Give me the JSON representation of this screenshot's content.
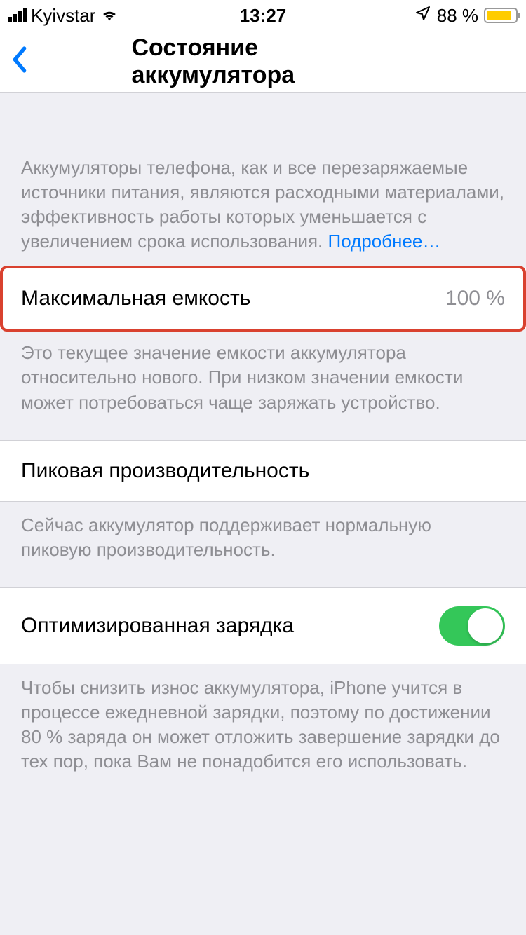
{
  "statusBar": {
    "carrier": "Kyivstar",
    "time": "13:27",
    "batteryPercent": "88 %"
  },
  "nav": {
    "title": "Состояние аккумулятора"
  },
  "intro": {
    "text": "Аккумуляторы телефона, как и все перезаряжаемые источники питания, являются расходными материалами, эффективность работы которых уменьшается с увеличением срока использования. ",
    "linkText": "Подробнее…"
  },
  "maxCapacity": {
    "label": "Максимальная емкость",
    "value": "100 %",
    "footer": "Это текущее значение емкости аккумулятора относительно нового. При низком значении емкости может потребоваться чаще заряжать устройство."
  },
  "peakPerformance": {
    "label": "Пиковая производительность",
    "footer": "Сейчас аккумулятор поддерживает нормальную пиковую производительность."
  },
  "optimizedCharging": {
    "label": "Оптимизированная зарядка",
    "footer": "Чтобы снизить износ аккумулятора, iPhone учится в процессе ежедневной зарядки, поэтому по достижении 80 % заряда он может отложить завершение зарядки до тех пор, пока Вам не понадобится его использовать."
  }
}
